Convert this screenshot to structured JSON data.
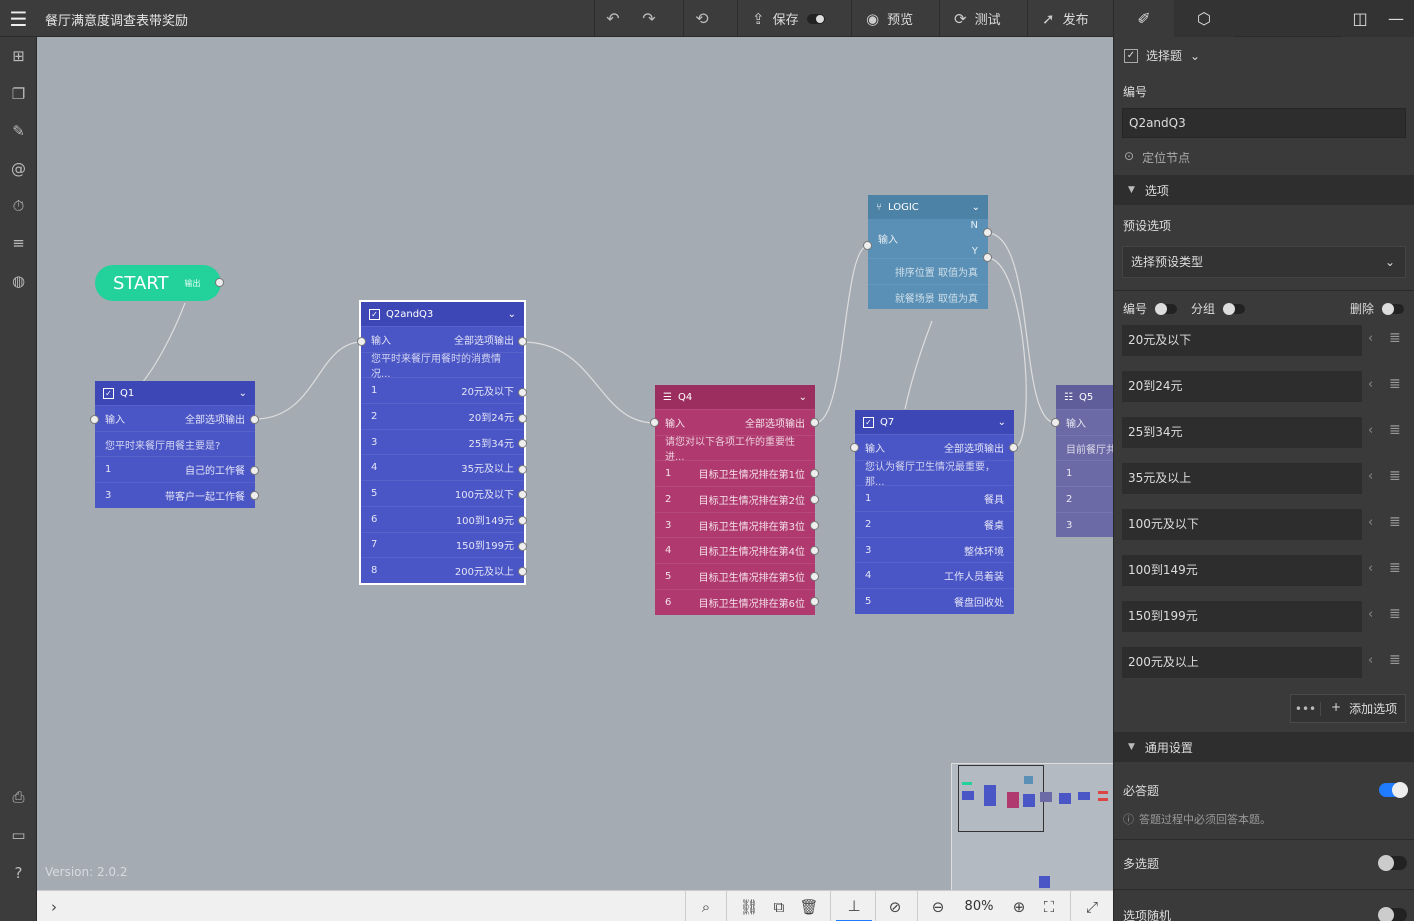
{
  "title": "餐厅满意度调查表带奖励",
  "toolbar": {
    "save": "保存",
    "preview": "预览",
    "test": "测试",
    "publish": "发布"
  },
  "canvas": {
    "version": "Version: 2.0.2",
    "start": {
      "label": "START",
      "out": "输出"
    },
    "q1": {
      "name": "Q1",
      "input": "输入",
      "output": "全部选项输出",
      "question": "您平时来餐厅用餐主要是?",
      "rows": [
        {
          "n": "1",
          "t": "自己的工作餐"
        },
        {
          "n": "3",
          "t": "带客户一起工作餐"
        }
      ]
    },
    "q2": {
      "name": "Q2andQ3",
      "input": "输入",
      "output": "全部选项输出",
      "question": "您平时来餐厅用餐时的消费情况...",
      "rows": [
        {
          "n": "1",
          "t": "20元及以下"
        },
        {
          "n": "2",
          "t": "20到24元"
        },
        {
          "n": "3",
          "t": "25到34元"
        },
        {
          "n": "4",
          "t": "35元及以上"
        },
        {
          "n": "5",
          "t": "100元及以下"
        },
        {
          "n": "6",
          "t": "100到149元"
        },
        {
          "n": "7",
          "t": "150到199元"
        },
        {
          "n": "8",
          "t": "200元及以上"
        }
      ]
    },
    "q4": {
      "name": "Q4",
      "input": "输入",
      "output": "全部选项输出",
      "question": "请您对以下各项工作的重要性进...",
      "rows": [
        {
          "n": "1",
          "t": "目标卫生情况排在第1位"
        },
        {
          "n": "2",
          "t": "目标卫生情况排在第2位"
        },
        {
          "n": "3",
          "t": "目标卫生情况排在第3位"
        },
        {
          "n": "4",
          "t": "目标卫生情况排在第4位"
        },
        {
          "n": "5",
          "t": "目标卫生情况排在第5位"
        },
        {
          "n": "6",
          "t": "目标卫生情况排在第6位"
        }
      ]
    },
    "logic": {
      "name": "LOGIC",
      "input": "输入",
      "n": "N",
      "y": "Y",
      "r1": "排序位置 取值为真",
      "r2": "就餐场景 取值为真"
    },
    "q7": {
      "name": "Q7",
      "input": "输入",
      "output": "全部选项输出",
      "question": "您认为餐厅卫生情况最重要，那...",
      "rows": [
        {
          "n": "1",
          "t": "餐具"
        },
        {
          "n": "2",
          "t": "餐桌"
        },
        {
          "n": "3",
          "t": "整体环境"
        },
        {
          "n": "4",
          "t": "工作人员着装"
        },
        {
          "n": "5",
          "t": "餐盘回收处"
        }
      ]
    },
    "q5": {
      "name": "Q5",
      "input": "输入",
      "question": "目前餐厅共",
      "rows": [
        "1",
        "2",
        "3"
      ]
    }
  },
  "bottom": {
    "zoom": "80%"
  },
  "panel": {
    "type": "选择题",
    "id_label": "编号",
    "id_value": "Q2andQ3",
    "locate": "定位节点",
    "options_section": "选项",
    "preset_label": "预设选项",
    "preset_placeholder": "选择预设类型",
    "number_toggle": "编号",
    "group_toggle": "分组",
    "delete_toggle": "删除",
    "options": [
      "20元及以下",
      "20到24元",
      "25到34元",
      "35元及以上",
      "100元及以下",
      "100到149元",
      "150到199元",
      "200元及以上"
    ],
    "add_option": "添加选项",
    "general_section": "通用设置",
    "required": "必答题",
    "required_hint": "答题过程中必须回答本题。",
    "multi": "多选题",
    "random": "选项随机"
  },
  "colors": {
    "q": "#4a55c6",
    "q4": "#b03a6f",
    "logic": "#5a90b5",
    "q5": "#6c6aa6",
    "start": "#23d29a",
    "canvas": "#a4abb3"
  }
}
